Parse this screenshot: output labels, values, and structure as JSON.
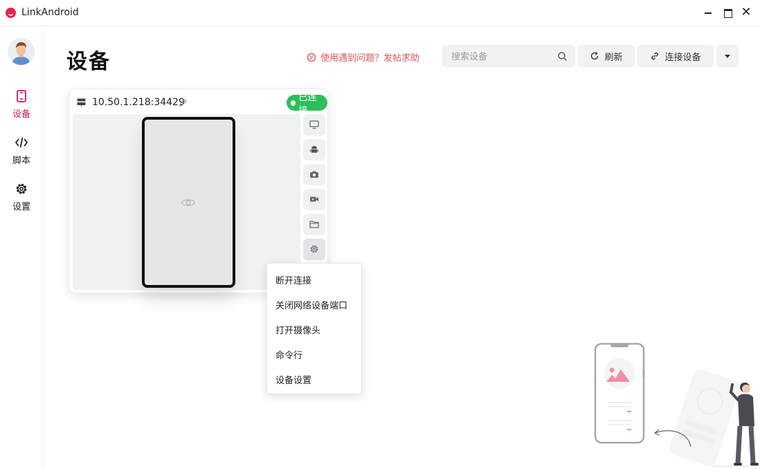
{
  "window": {
    "title": "LinkAndroid",
    "close_glyph": "✕"
  },
  "sidebar": {
    "items": [
      {
        "label": "设备",
        "icon": "phone-icon",
        "active": true
      },
      {
        "label": "脚本",
        "icon": "code-icon",
        "active": false
      },
      {
        "label": "设置",
        "icon": "gear-icon",
        "active": false
      }
    ]
  },
  "header": {
    "title": "设备",
    "help_text": "使用遇到问题？发帖求助",
    "search_placeholder": "搜索设备",
    "refresh_label": "刷新",
    "connect_label": "连接设备"
  },
  "device": {
    "address": "10.50.1.218:34429",
    "status": "已连接",
    "tools": [
      "screen-mirror-icon",
      "android-icon",
      "camera-icon",
      "record-icon",
      "folder-icon",
      "gear-icon"
    ]
  },
  "context_menu": {
    "items": [
      "断开连接",
      "关闭网络设备端口",
      "打开摄像头",
      "命令行",
      "设备设置"
    ]
  },
  "colors": {
    "accent": "#d0175b",
    "status_green": "#2bbf5b",
    "help_red": "#e0555b"
  }
}
